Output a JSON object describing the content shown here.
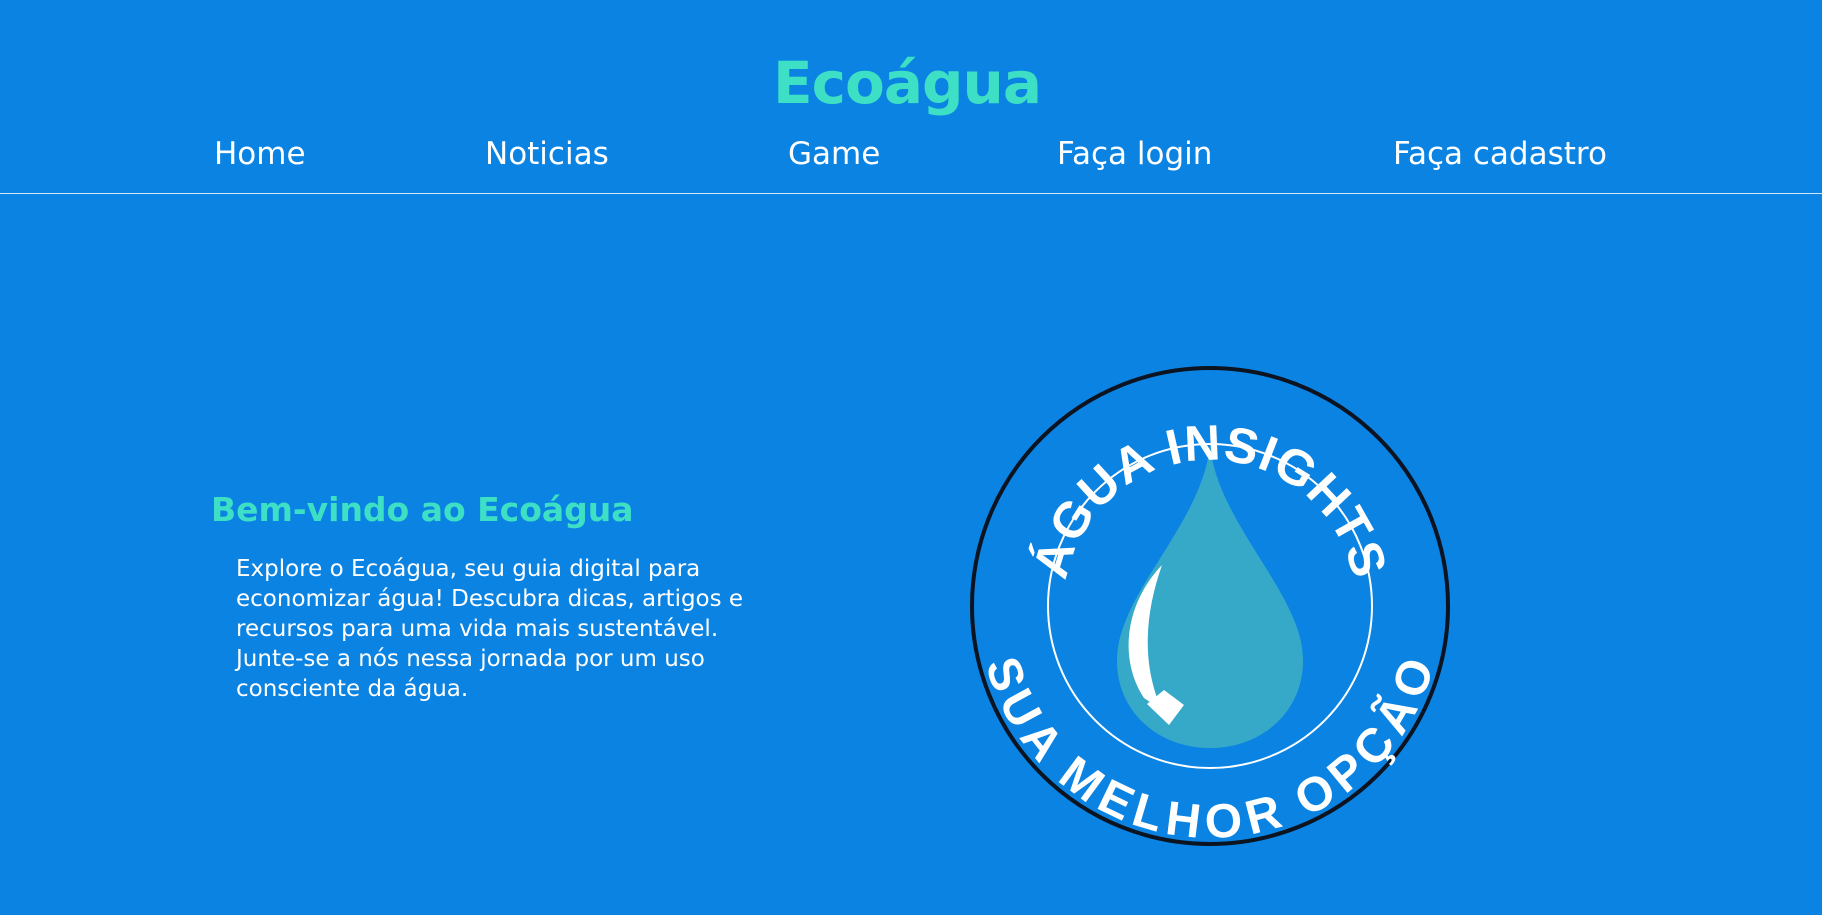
{
  "site": {
    "title": "Ecoágua"
  },
  "nav": {
    "items": [
      {
        "label": "Home"
      },
      {
        "label": "Noticias"
      },
      {
        "label": "Game"
      },
      {
        "label": "Faça login"
      },
      {
        "label": "Faça cadastro"
      }
    ]
  },
  "hero": {
    "title": "Bem-vindo ao Ecoágua",
    "description": "Explore o Ecoágua, seu guia digital para economizar água! Descubra dicas, artigos e recursos para uma vida mais sustentável. Junte-se a nós nessa jornada por um uso consciente da água."
  },
  "logo": {
    "top_text": "ÁGUA INSIGHTS",
    "bottom_text": "SUA MELHOR OPÇÃO",
    "icon": "water-drop-icon"
  },
  "colors": {
    "background": "#0a83e3",
    "accent": "#3ee0c5",
    "drop": "#36a9c9",
    "text": "#ffffff"
  }
}
